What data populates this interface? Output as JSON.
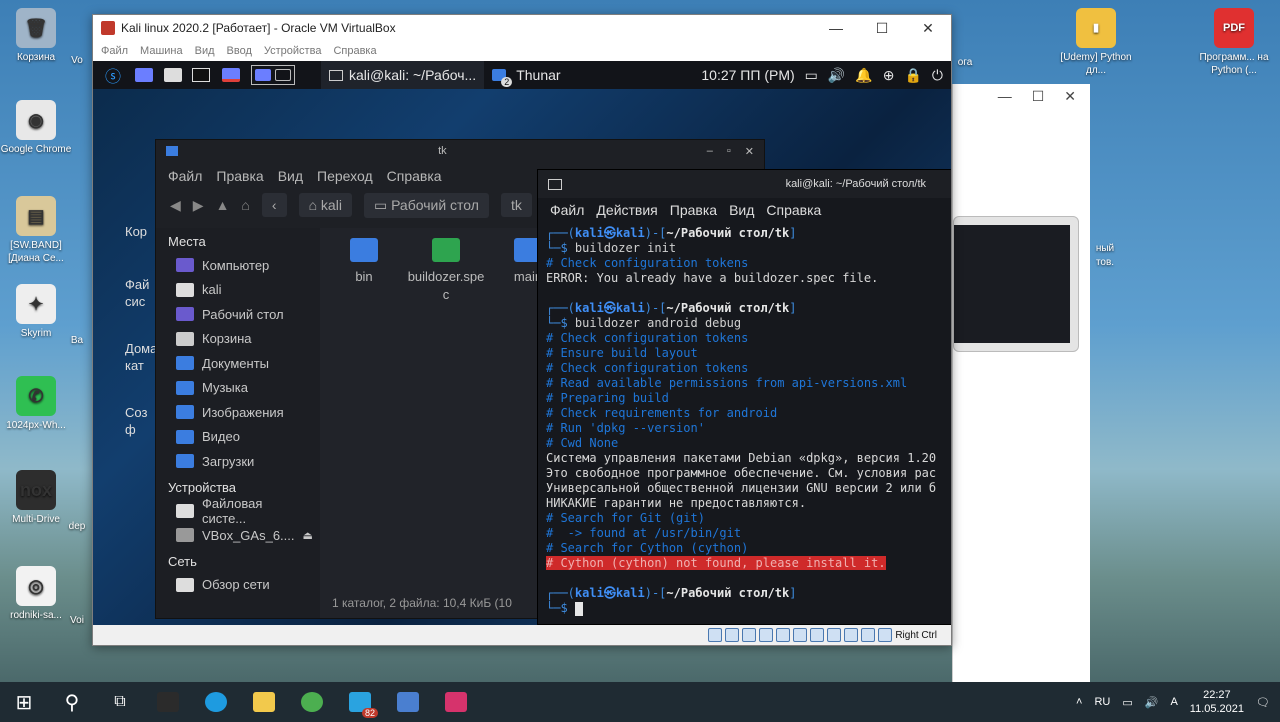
{
  "desktop": {
    "left_icons": [
      {
        "label": "Корзина",
        "color": "#9fb4c8",
        "glyph": "🗑"
      },
      {
        "label": "Google Chrome",
        "color": "#e8e8e8",
        "glyph": "◉"
      },
      {
        "label": "[SW.BAND] [Диана Се...",
        "color": "#d9c89a",
        "glyph": "▤"
      },
      {
        "label": "Skyrim",
        "color": "#eeeeee",
        "glyph": "✦"
      },
      {
        "label": "1024px-Wh...",
        "color": "#2fbf52",
        "glyph": "✆"
      },
      {
        "label": "Multi-Drive",
        "color": "#2d2d2d",
        "glyph": "nox"
      },
      {
        "label": "rodniki-sa...",
        "color": "#f2f2f2",
        "glyph": "◎"
      }
    ],
    "col2_labels": [
      "Vo",
      "Ba",
      "dep",
      "Voi"
    ],
    "right_icons": [
      {
        "label": "[Udemy] Python дл...",
        "color": "#f0c040",
        "glyph": "▮"
      },
      {
        "label": "Программ... на Python (...",
        "color": "#e03030",
        "glyph": "PDF"
      }
    ],
    "partial_right_labels": [
      "ога",
      "ный",
      "тов."
    ]
  },
  "vbox": {
    "title": "Kali linux 2020.2 [Работает] - Oracle VM VirtualBox",
    "menu": [
      "Файл",
      "Машина",
      "Вид",
      "Ввод",
      "Устройства",
      "Справка"
    ],
    "status_host_key": "Right Ctrl",
    "window_buttons": [
      "—",
      "☐",
      "✕"
    ]
  },
  "kali_panel": {
    "task_terminal": "kali@kali: ~/Рабоч...",
    "task_thunar": "Thunar",
    "thunar_count": "2",
    "clock": "10:27 ПП (PM)"
  },
  "thunar": {
    "title": "tk",
    "menu": [
      "Файл",
      "Правка",
      "Вид",
      "Переход",
      "Справка"
    ],
    "crumbs": [
      "kali",
      "Рабочий стол",
      "tk"
    ],
    "places_header": "Места",
    "places": [
      {
        "label": "Компьютер",
        "color": "#6a5acd"
      },
      {
        "label": "kali",
        "color": "#dddddd"
      },
      {
        "label": "Рабочий стол",
        "color": "#6a5acd"
      },
      {
        "label": "Корзина",
        "color": "#cccccc"
      },
      {
        "label": "Документы",
        "color": "#3b7de0"
      },
      {
        "label": "Музыка",
        "color": "#3b7de0"
      },
      {
        "label": "Изображения",
        "color": "#3b7de0"
      },
      {
        "label": "Видео",
        "color": "#3b7de0"
      },
      {
        "label": "Загрузки",
        "color": "#3b7de0"
      }
    ],
    "devices_header": "Устройства",
    "devices": [
      {
        "label": "Файловая систе...",
        "color": "#dddddd"
      },
      {
        "label": "VBox_GAs_6....",
        "color": "#999999"
      }
    ],
    "network_header": "Сеть",
    "network": [
      {
        "label": "Обзор сети",
        "color": "#dddddd"
      }
    ],
    "files": [
      {
        "name": "bin",
        "color": "#3b7de0"
      },
      {
        "name": "buildozer.spec",
        "color": "#2ea44f"
      },
      {
        "name": "main",
        "color": "#3b7de0"
      }
    ],
    "status": "1 каталог, 2 файла: 10,4 КиБ (10"
  },
  "terminal": {
    "title": "kali@kali: ~/Рабочий стол/tk",
    "menu": [
      "Файл",
      "Действия",
      "Правка",
      "Вид",
      "Справка"
    ],
    "prompt_user": "kali",
    "prompt_host": "kali",
    "prompt_path_tk": "~/Рабочий стол/tk",
    "cmd1": "buildozer init",
    "out1": [
      {
        "t": "comm",
        "s": "# Check configuration tokens"
      },
      {
        "t": "norm",
        "s": "ERROR: You already have a buildozer.spec file."
      }
    ],
    "cmd2": "buildozer android debug",
    "out2": [
      {
        "t": "comm",
        "s": "# Check configuration tokens"
      },
      {
        "t": "comm",
        "s": "# Ensure build layout"
      },
      {
        "t": "comm",
        "s": "# Check configuration tokens"
      },
      {
        "t": "comm",
        "s": "# Read available permissions from api-versions.xml"
      },
      {
        "t": "comm",
        "s": "# Preparing build"
      },
      {
        "t": "comm",
        "s": "# Check requirements for android"
      },
      {
        "t": "comm",
        "s": "# Run 'dpkg --version'"
      },
      {
        "t": "comm",
        "s": "# Cwd None"
      },
      {
        "t": "norm",
        "s": "Система управления пакетами Debian «dpkg», версия 1.20"
      },
      {
        "t": "norm",
        "s": "Это свободное программное обеспечение. См. условия рас"
      },
      {
        "t": "norm",
        "s": "Универсальной общественной лицензии GNU версии 2 или б"
      },
      {
        "t": "norm",
        "s": "НИКАКИЕ гарантии не предоставляются."
      },
      {
        "t": "comm",
        "s": "# Search for Git (git)"
      },
      {
        "t": "comm",
        "s": "#  -> found at /usr/bin/git"
      },
      {
        "t": "comm",
        "s": "# Search for Cython (cython)"
      }
    ],
    "error_line": "Cython (cython) not found, please install it.",
    "prompt_path_desk": "~/Рабочий стол/tk"
  },
  "taskbar": {
    "lang": "RU",
    "time": "22:27",
    "date": "11.05.2021",
    "telegram_badge": "82",
    "apps": [
      {
        "name": "start",
        "color": "#ffffff"
      },
      {
        "name": "search",
        "color": "#ffffff"
      },
      {
        "name": "task-view",
        "color": "#ffffff"
      },
      {
        "name": "terminal",
        "color": "#2b2b2b"
      },
      {
        "name": "edge",
        "color": "#1e9be0"
      },
      {
        "name": "explorer",
        "color": "#f2c94c"
      },
      {
        "name": "chrome",
        "color": "#4caf50"
      },
      {
        "name": "telegram",
        "color": "#2aa3e0"
      },
      {
        "name": "virtualbox",
        "color": "#4a7fd0"
      },
      {
        "name": "app-red",
        "color": "#d6336c"
      }
    ]
  }
}
